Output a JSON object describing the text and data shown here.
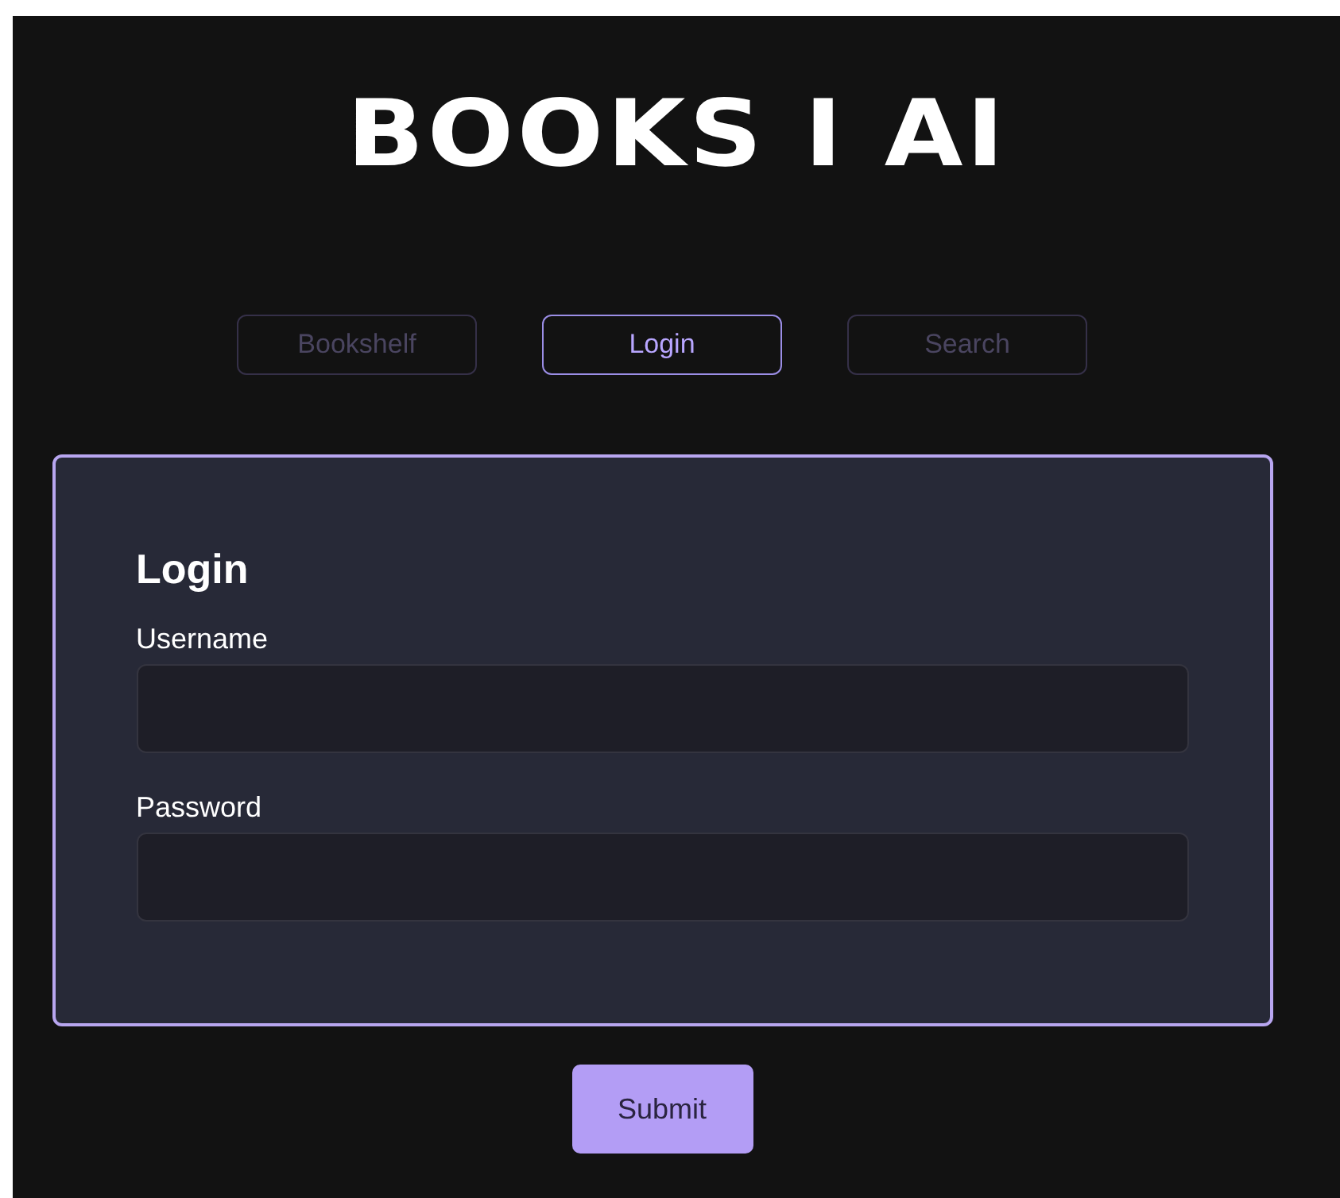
{
  "logo": "BOOKS I AI",
  "tabs": [
    {
      "label": "Bookshelf",
      "selected": false
    },
    {
      "label": "Login",
      "selected": true
    },
    {
      "label": "Search",
      "selected": false
    }
  ],
  "form": {
    "title": "Login",
    "fields": [
      {
        "label": "Username"
      },
      {
        "label": "Password"
      }
    ],
    "submit": "Submit"
  }
}
